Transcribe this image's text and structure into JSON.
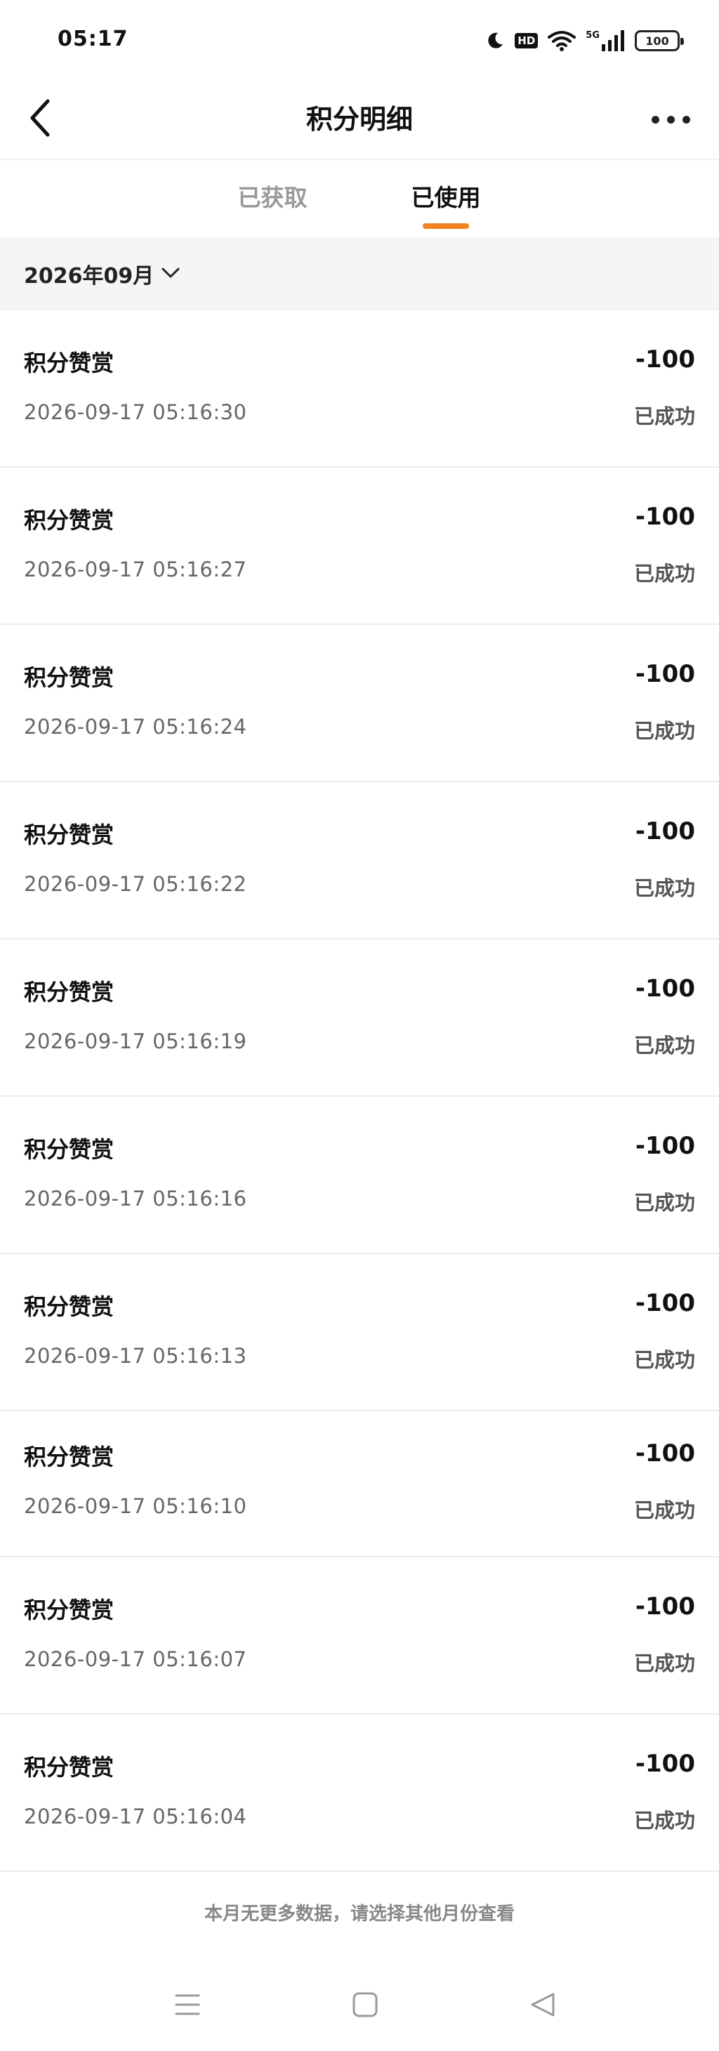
{
  "status_bar": {
    "time": "05:17",
    "hd_label": "HD",
    "network_label": "5G",
    "battery_level": "100",
    "icons": [
      "moon-icon",
      "hd-icon",
      "wifi-icon",
      "signal-5g-icon",
      "battery-icon"
    ]
  },
  "nav": {
    "title": "积分明细",
    "back_icon": "chevron-left-icon",
    "more_icon": "more-dots-icon"
  },
  "tabs": [
    {
      "label": "已获取",
      "active": false
    },
    {
      "label": "已使用",
      "active": true
    }
  ],
  "accent_color": "#f58220",
  "month_filter": {
    "label": "2026年09月",
    "icon": "chevron-down-icon"
  },
  "records": [
    {
      "title": "积分赞赏",
      "amount": "-100",
      "time": "2026-09-17 05:16:30",
      "status": "已成功"
    },
    {
      "title": "积分赞赏",
      "amount": "-100",
      "time": "2026-09-17 05:16:27",
      "status": "已成功"
    },
    {
      "title": "积分赞赏",
      "amount": "-100",
      "time": "2026-09-17 05:16:24",
      "status": "已成功"
    },
    {
      "title": "积分赞赏",
      "amount": "-100",
      "time": "2026-09-17 05:16:22",
      "status": "已成功"
    },
    {
      "title": "积分赞赏",
      "amount": "-100",
      "time": "2026-09-17 05:16:19",
      "status": "已成功"
    },
    {
      "title": "积分赞赏",
      "amount": "-100",
      "time": "2026-09-17 05:16:16",
      "status": "已成功"
    },
    {
      "title": "积分赞赏",
      "amount": "-100",
      "time": "2026-09-17 05:16:13",
      "status": "已成功"
    },
    {
      "title": "积分赞赏",
      "amount": "-100",
      "time": "2026-09-17 05:16:10",
      "status": "已成功"
    },
    {
      "title": "积分赞赏",
      "amount": "-100",
      "time": "2026-09-17 05:16:07",
      "status": "已成功"
    },
    {
      "title": "积分赞赏",
      "amount": "-100",
      "time": "2026-09-17 05:16:04",
      "status": "已成功"
    }
  ],
  "footer_note": "本月无更多数据，请选择其他月份查看",
  "system_nav": {
    "icons": [
      "menu-icon",
      "home-icon",
      "back-triangle-icon"
    ]
  }
}
